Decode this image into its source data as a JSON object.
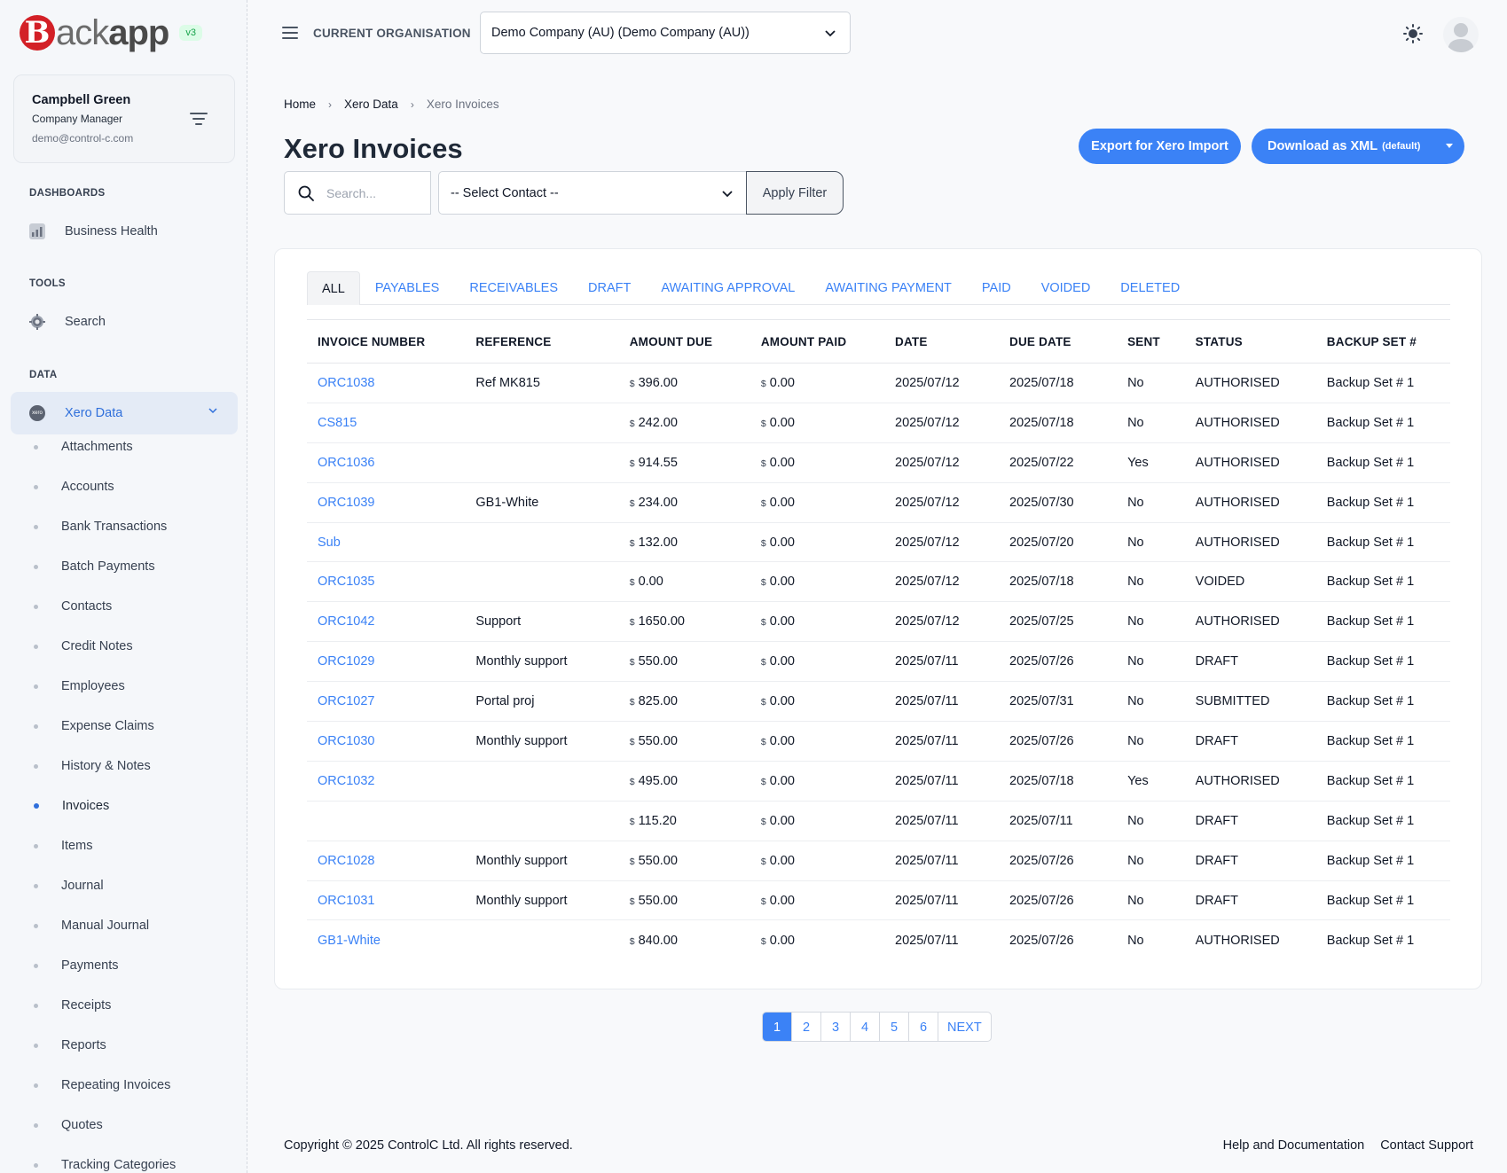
{
  "app": {
    "logo_mark": "B",
    "logo_light": "ack",
    "logo_bold": "app",
    "version": "v3"
  },
  "user": {
    "name": "Campbell Green",
    "role": "Company Manager",
    "email": "demo@control-c.com"
  },
  "sidebar": {
    "dashboards_label": "DASHBOARDS",
    "business_health": "Business Health",
    "tools_label": "TOOLS",
    "search": "Search",
    "data_label": "DATA",
    "xero_data": "Xero Data",
    "xero_logo_text": "xero",
    "items": [
      "Attachments",
      "Accounts",
      "Bank Transactions",
      "Batch Payments",
      "Contacts",
      "Credit Notes",
      "Employees",
      "Expense Claims",
      "History & Notes",
      "Invoices",
      "Items",
      "Journal",
      "Manual Journal",
      "Payments",
      "Receipts",
      "Reports",
      "Repeating Invoices",
      "Quotes",
      "Tracking Categories"
    ],
    "active_item": "Invoices"
  },
  "topbar": {
    "org_label": "CURRENT ORGANISATION",
    "org_value": "Demo Company (AU) (Demo Company (AU))"
  },
  "breadcrumb": {
    "home": "Home",
    "xero_data": "Xero Data",
    "current": "Xero Invoices"
  },
  "page": {
    "title": "Xero Invoices"
  },
  "actions": {
    "export_label": "Export for Xero Import",
    "download_label": "Download as XML",
    "download_default": "(default)"
  },
  "filters": {
    "search_placeholder": "Search...",
    "contact_value": "-- Select Contact --",
    "apply_label": "Apply Filter"
  },
  "tabs": [
    "ALL",
    "PAYABLES",
    "RECEIVABLES",
    "DRAFT",
    "AWAITING APPROVAL",
    "AWAITING PAYMENT",
    "PAID",
    "VOIDED",
    "DELETED"
  ],
  "table": {
    "headers": [
      "INVOICE NUMBER",
      "REFERENCE",
      "AMOUNT DUE",
      "AMOUNT PAID",
      "DATE",
      "DUE DATE",
      "SENT",
      "STATUS",
      "BACKUP SET #"
    ],
    "currency": "$",
    "rows": [
      {
        "invoice": "ORC1038",
        "reference": "Ref MK815",
        "amount_due": "396.00",
        "amount_paid": "0.00",
        "date": "2025/07/12",
        "due_date": "2025/07/18",
        "sent": "No",
        "status": "AUTHORISED",
        "backup": "Backup Set # 1"
      },
      {
        "invoice": "CS815",
        "reference": "",
        "amount_due": "242.00",
        "amount_paid": "0.00",
        "date": "2025/07/12",
        "due_date": "2025/07/18",
        "sent": "No",
        "status": "AUTHORISED",
        "backup": "Backup Set # 1"
      },
      {
        "invoice": "ORC1036",
        "reference": "",
        "amount_due": "914.55",
        "amount_paid": "0.00",
        "date": "2025/07/12",
        "due_date": "2025/07/22",
        "sent": "Yes",
        "status": "AUTHORISED",
        "backup": "Backup Set # 1"
      },
      {
        "invoice": "ORC1039",
        "reference": "GB1-White",
        "amount_due": "234.00",
        "amount_paid": "0.00",
        "date": "2025/07/12",
        "due_date": "2025/07/30",
        "sent": "No",
        "status": "AUTHORISED",
        "backup": "Backup Set # 1"
      },
      {
        "invoice": "Sub",
        "reference": "",
        "amount_due": "132.00",
        "amount_paid": "0.00",
        "date": "2025/07/12",
        "due_date": "2025/07/20",
        "sent": "No",
        "status": "AUTHORISED",
        "backup": "Backup Set # 1"
      },
      {
        "invoice": "ORC1035",
        "reference": "",
        "amount_due": "0.00",
        "amount_paid": "0.00",
        "date": "2025/07/12",
        "due_date": "2025/07/18",
        "sent": "No",
        "status": "VOIDED",
        "backup": "Backup Set # 1"
      },
      {
        "invoice": "ORC1042",
        "reference": "Support",
        "amount_due": "1650.00",
        "amount_paid": "0.00",
        "date": "2025/07/12",
        "due_date": "2025/07/25",
        "sent": "No",
        "status": "AUTHORISED",
        "backup": "Backup Set # 1"
      },
      {
        "invoice": "ORC1029",
        "reference": "Monthly support",
        "amount_due": "550.00",
        "amount_paid": "0.00",
        "date": "2025/07/11",
        "due_date": "2025/07/26",
        "sent": "No",
        "status": "DRAFT",
        "backup": "Backup Set # 1"
      },
      {
        "invoice": "ORC1027",
        "reference": "Portal proj",
        "amount_due": "825.00",
        "amount_paid": "0.00",
        "date": "2025/07/11",
        "due_date": "2025/07/31",
        "sent": "No",
        "status": "SUBMITTED",
        "backup": "Backup Set # 1"
      },
      {
        "invoice": "ORC1030",
        "reference": "Monthly support",
        "amount_due": "550.00",
        "amount_paid": "0.00",
        "date": "2025/07/11",
        "due_date": "2025/07/26",
        "sent": "No",
        "status": "DRAFT",
        "backup": "Backup Set # 1"
      },
      {
        "invoice": "ORC1032",
        "reference": "",
        "amount_due": "495.00",
        "amount_paid": "0.00",
        "date": "2025/07/11",
        "due_date": "2025/07/18",
        "sent": "Yes",
        "status": "AUTHORISED",
        "backup": "Backup Set # 1"
      },
      {
        "invoice": "",
        "reference": "",
        "amount_due": "115.20",
        "amount_paid": "0.00",
        "date": "2025/07/11",
        "due_date": "2025/07/11",
        "sent": "No",
        "status": "DRAFT",
        "backup": "Backup Set # 1"
      },
      {
        "invoice": "ORC1028",
        "reference": "Monthly support",
        "amount_due": "550.00",
        "amount_paid": "0.00",
        "date": "2025/07/11",
        "due_date": "2025/07/26",
        "sent": "No",
        "status": "DRAFT",
        "backup": "Backup Set # 1"
      },
      {
        "invoice": "ORC1031",
        "reference": "Monthly support",
        "amount_due": "550.00",
        "amount_paid": "0.00",
        "date": "2025/07/11",
        "due_date": "2025/07/26",
        "sent": "No",
        "status": "DRAFT",
        "backup": "Backup Set # 1"
      },
      {
        "invoice": "GB1-White",
        "reference": "",
        "amount_due": "840.00",
        "amount_paid": "0.00",
        "date": "2025/07/11",
        "due_date": "2025/07/26",
        "sent": "No",
        "status": "AUTHORISED",
        "backup": "Backup Set # 1"
      }
    ]
  },
  "pagination": {
    "pages": [
      "1",
      "2",
      "3",
      "4",
      "5",
      "6"
    ],
    "active": "1",
    "next": "NEXT"
  },
  "footer": {
    "copyright": "Copyright © 2025 ControlC Ltd. All rights reserved.",
    "help": "Help and Documentation",
    "support": "Contact Support"
  },
  "icons": {
    "menu": "hamburger-icon",
    "theme": "sun-icon",
    "filter": "filter-icon",
    "search": "search-icon",
    "chevron": "chevron-down-icon"
  },
  "colors": {
    "accent": "#3b82f6",
    "brand_red": "#d32027",
    "active_nav_bg": "#e4ebf6"
  }
}
